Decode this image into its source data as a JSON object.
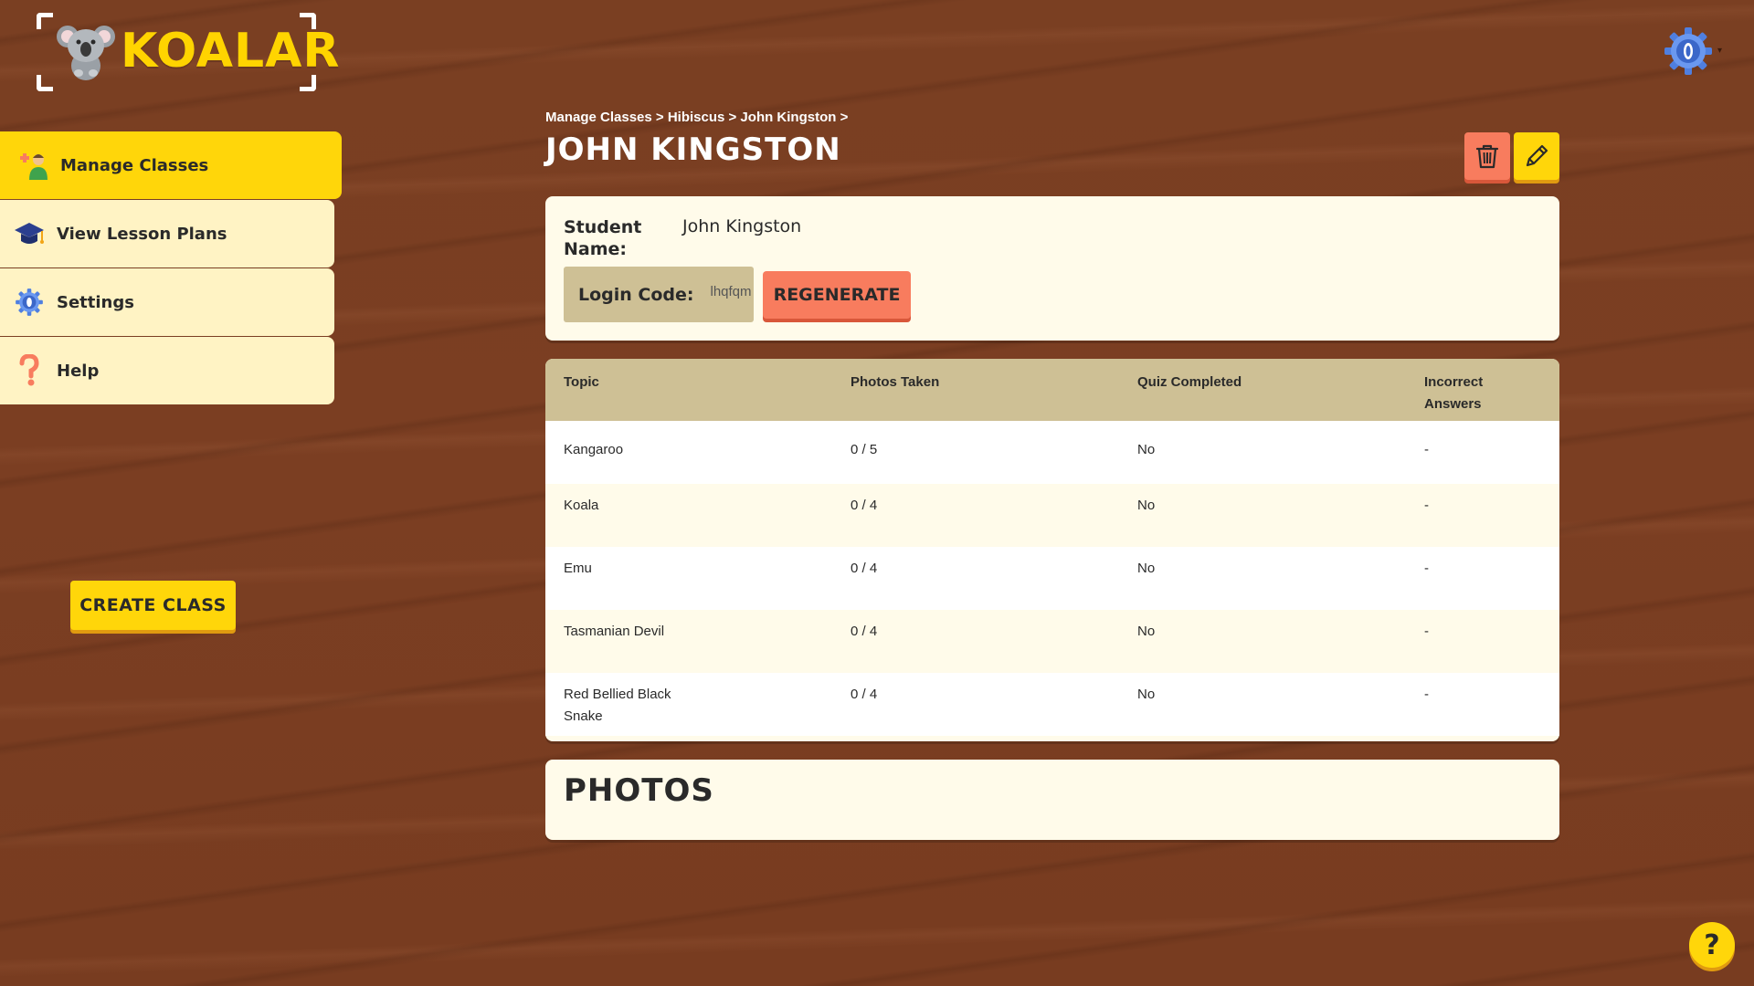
{
  "brand": {
    "name": "KOALAR"
  },
  "sidebar": {
    "items": [
      {
        "label": "Manage Classes",
        "icon": "teacher-icon",
        "active": true
      },
      {
        "label": "View Lesson Plans",
        "icon": "graduation-cap-icon",
        "active": false
      },
      {
        "label": "Settings",
        "icon": "gear-icon",
        "active": false
      },
      {
        "label": "Help",
        "icon": "question-icon",
        "active": false
      }
    ],
    "create_class_label": "CREATE CLASS"
  },
  "breadcrumb": "Manage Classes > Hibiscus > John Kingston >",
  "page_title": "JOHN KINGSTON",
  "student": {
    "name_label": "Student Name:",
    "name_value": "John Kingston",
    "login_label": "Login Code:",
    "login_value": "lhqfqm",
    "regenerate_label": "REGENERATE"
  },
  "table": {
    "headers": [
      "Topic",
      "Photos Taken",
      "Quiz Completed",
      "Incorrect Answers"
    ],
    "rows": [
      {
        "topic": "Kangaroo",
        "photos": "0 / 5",
        "quiz": "No",
        "incorrect": "-"
      },
      {
        "topic": "Koala",
        "photos": "0 / 4",
        "quiz": "No",
        "incorrect": "-"
      },
      {
        "topic": "Emu",
        "photos": "0 / 4",
        "quiz": "No",
        "incorrect": "-"
      },
      {
        "topic": "Tasmanian Devil",
        "photos": "0 / 4",
        "quiz": "No",
        "incorrect": "-"
      },
      {
        "topic": "Red Bellied Black Snake",
        "photos": "0 / 4",
        "quiz": "No",
        "incorrect": "-"
      }
    ]
  },
  "photos": {
    "title": "PHOTOS"
  },
  "help_fab": {
    "label": "?"
  },
  "colors": {
    "accent_yellow": "#ffd60a",
    "accent_coral": "#f87c5e",
    "card_bg": "#fffbea",
    "header_tan": "#cec095",
    "nav_bg": "#fff3c4",
    "wood_bg": "#7a3f22"
  }
}
